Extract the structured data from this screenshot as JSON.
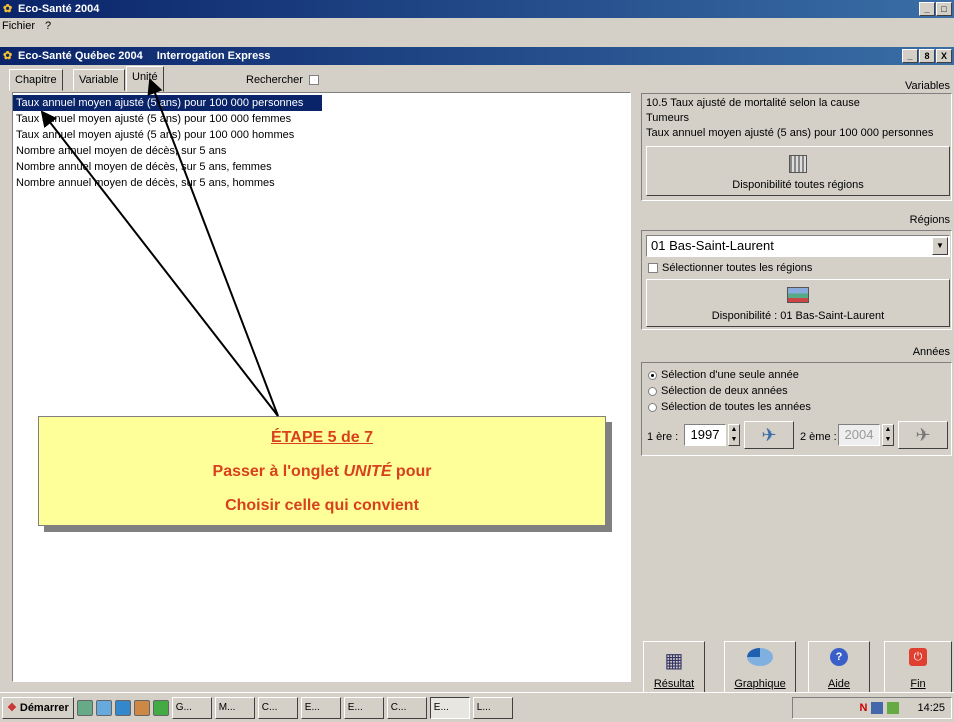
{
  "outer_window": {
    "title": "Eco-Santé 2004",
    "controls": [
      "_",
      "□"
    ]
  },
  "menu": [
    "Fichier",
    "?"
  ],
  "inner_window": {
    "title": "Eco-Santé Québec 2004",
    "subtitle": "Interrogation Express",
    "controls": [
      "_",
      "8",
      "X"
    ]
  },
  "tabs": [
    "Chapitre",
    "Variable",
    "Unité"
  ],
  "search": {
    "label": "Rechercher"
  },
  "units_list": [
    "Taux annuel moyen ajusté (5 ans) pour 100 000 personnes",
    "Taux annuel moyen ajusté (5 ans) pour 100 000 femmes",
    "Taux annuel moyen ajusté (5 ans) pour 100 000 hommes",
    "Nombre annuel moyen de décès, sur 5 ans",
    "Nombre annuel moyen de décès, sur 5 ans, femmes",
    "Nombre annuel moyen de décès, sur 5 ans, hommes"
  ],
  "variables": {
    "heading": "Variables",
    "lines": [
      "10.5 Taux ajusté de mortalité selon la cause",
      "Tumeurs",
      "Taux annuel moyen ajusté (5 ans) pour 100 000 personnes"
    ],
    "button": "Disponibilité toutes régions"
  },
  "regions": {
    "heading": "Régions",
    "selected": "01 Bas-Saint-Laurent",
    "checkbox": "Sélectionner toutes les régions",
    "button": "Disponibilité : 01 Bas-Saint-Laurent"
  },
  "years": {
    "heading": "Années",
    "options": [
      "Sélection d'une seule année",
      "Sélection de deux années",
      "Sélection de toutes les années"
    ],
    "first_label": "1 ère :",
    "first_value": "1997",
    "second_label": "2 ème :",
    "second_value": "2004"
  },
  "actions": [
    "Résultat",
    "Graphique",
    "Aide",
    "Fin"
  ],
  "callout": {
    "line1": "ÉTAPE 5 de 7",
    "line2_a": "Passer à l'onglet ",
    "line2_em": "UNITÉ",
    "line2_b": " pour",
    "line3": "Choisir celle qui convient"
  },
  "taskbar": {
    "start": "Démarrer",
    "items": [
      "G...",
      "M...",
      "C...",
      "E...",
      "E...",
      "C...",
      "E...",
      "L..."
    ],
    "tray_letter": "N",
    "clock": "14:25"
  }
}
